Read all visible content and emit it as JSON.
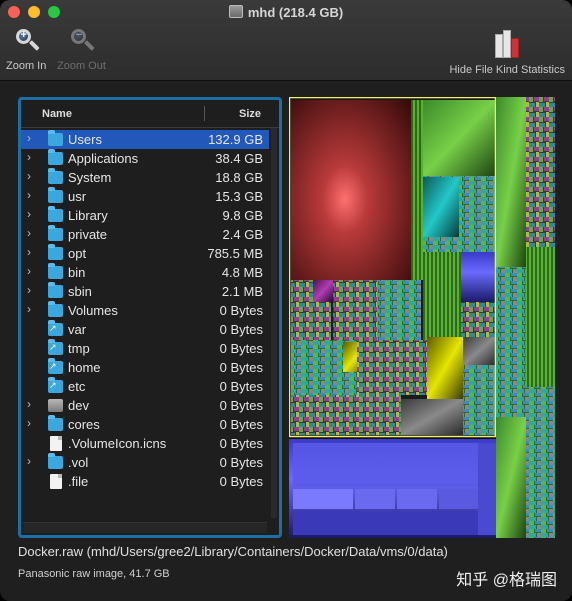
{
  "window": {
    "title": "mhd (218.4 GB)"
  },
  "toolbar": {
    "zoom_in": "Zoom In",
    "zoom_out": "Zoom Out",
    "kind_stats": "Hide File Kind Statistics"
  },
  "list": {
    "headers": {
      "name": "Name",
      "size": "Size"
    },
    "rows": [
      {
        "name": "Users",
        "size": "132.9 GB",
        "kind": "folder",
        "expandable": true,
        "selected": true
      },
      {
        "name": "Applications",
        "size": "38.4 GB",
        "kind": "folder",
        "expandable": true
      },
      {
        "name": "System",
        "size": "18.8 GB",
        "kind": "folder",
        "expandable": true
      },
      {
        "name": "usr",
        "size": "15.3 GB",
        "kind": "folder",
        "expandable": true
      },
      {
        "name": "Library",
        "size": "9.8 GB",
        "kind": "folder",
        "expandable": true
      },
      {
        "name": "private",
        "size": "2.4 GB",
        "kind": "folder",
        "expandable": true
      },
      {
        "name": "opt",
        "size": "785.5 MB",
        "kind": "folder",
        "expandable": true
      },
      {
        "name": "bin",
        "size": "4.8 MB",
        "kind": "folder",
        "expandable": true
      },
      {
        "name": "sbin",
        "size": "2.1 MB",
        "kind": "folder",
        "expandable": true
      },
      {
        "name": "Volumes",
        "size": "0 Bytes",
        "kind": "folder",
        "expandable": true
      },
      {
        "name": "var",
        "size": "0 Bytes",
        "kind": "alias",
        "expandable": false
      },
      {
        "name": "tmp",
        "size": "0 Bytes",
        "kind": "alias",
        "expandable": false
      },
      {
        "name": "home",
        "size": "0 Bytes",
        "kind": "alias",
        "expandable": false
      },
      {
        "name": "etc",
        "size": "0 Bytes",
        "kind": "alias",
        "expandable": false
      },
      {
        "name": "dev",
        "size": "0 Bytes",
        "kind": "disk",
        "expandable": true
      },
      {
        "name": "cores",
        "size": "0 Bytes",
        "kind": "folder",
        "expandable": true
      },
      {
        "name": ".VolumeIcon.icns",
        "size": "0 Bytes",
        "kind": "document",
        "expandable": false
      },
      {
        "name": ".vol",
        "size": "0 Bytes",
        "kind": "folder",
        "expandable": true
      },
      {
        "name": ".file",
        "size": "0 Bytes",
        "kind": "document",
        "expandable": false
      }
    ]
  },
  "status": {
    "path": "Docker.raw (mhd/Users/gree2/Library/Containers/Docker/Data/vms/0/data)",
    "kind": "Panasonic raw image, 41.7 GB"
  },
  "watermark": "知乎 @格瑞图",
  "colors": {
    "selection": "#2258b9",
    "panel_border": "#1e6ea6",
    "folder": "#3aa7df",
    "treemap_highlight": "#f5f06a"
  }
}
